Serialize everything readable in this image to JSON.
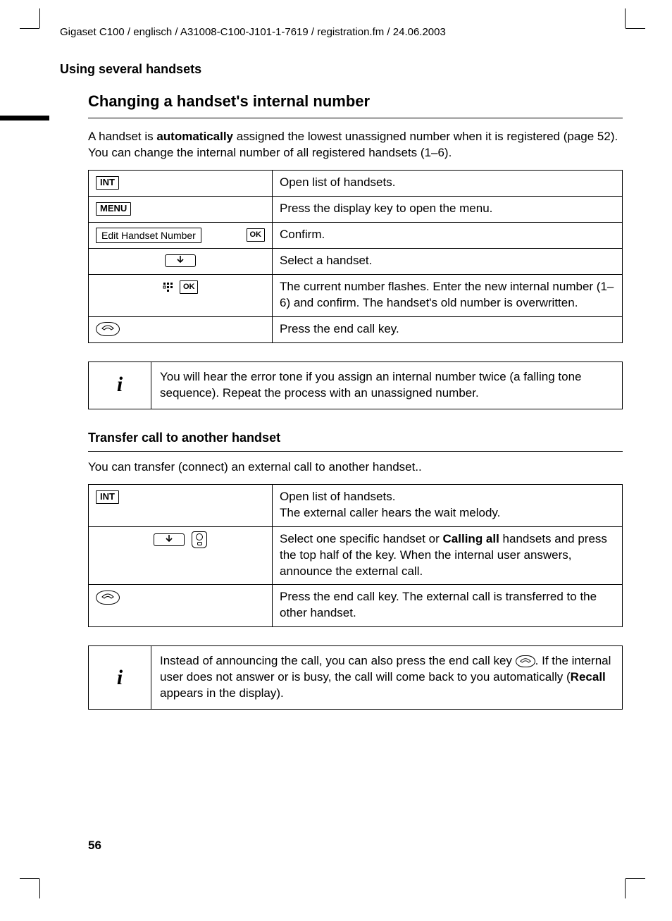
{
  "header_path": "Gigaset C100 / englisch / A31008-C100-J101-1-7619 / registration.fm / 24.06.2003",
  "section_title": "Using several handsets",
  "h2_title": "Changing a handset's internal number",
  "intro_pre": "A handset is ",
  "intro_bold": "automatically",
  "intro_post": " assigned the lowest unassigned number when it is registered (page 52). You can change the internal number of all registered handsets (1–6).",
  "tbl1": {
    "r1_key": "INT",
    "r1_txt": "Open list of handsets.",
    "r2_key": "MENU",
    "r2_txt": "Press the display key to open the menu.",
    "r3_left": "Edit Handset Number",
    "r3_right": "OK",
    "r3_txt": "Confirm.",
    "r4_txt": "Select a handset.",
    "r5_right": "OK",
    "r5_txt": "The current number flashes. Enter the new internal number (1–6) and confirm. The handset's old number is overwritten.",
    "r6_txt": "Press the end call key."
  },
  "info1": "You will hear the error tone if you assign an internal number twice (a falling tone sequence). Repeat the process with an unassigned number.",
  "h3_title": "Transfer call to another handset",
  "para2": "You can transfer (connect) an external call to another handset..",
  "tbl2": {
    "r1_key": "INT",
    "r1_l1": "Open list of handsets.",
    "r1_l2": "The external caller hears the wait melody.",
    "r2_pre": "Select one specific handset or ",
    "r2_bold": "Calling all",
    "r2_post": " handsets and press the top half of the key. When the internal user answers, announce the external call.",
    "r3_txt": "Press the end call key. The external call is transferred to the other handset."
  },
  "info2_pre": "Instead of announcing the call, you can also press the end call key ",
  "info2_mid": ". If the internal user does not answer or is busy, the call will come back to you automatically (",
  "info2_bold": "Recall",
  "info2_post": " appears in the display).",
  "page_number": "56"
}
